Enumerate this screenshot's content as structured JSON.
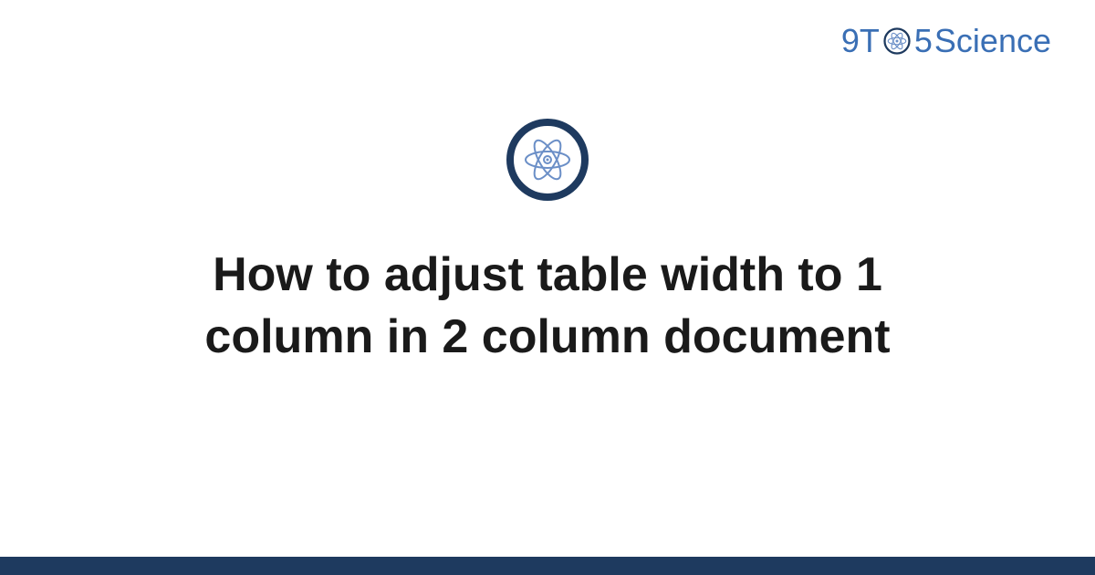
{
  "brand": {
    "prefix": "9T",
    "suffix": "5",
    "name": "Science"
  },
  "title": "How to adjust table width to 1 column in 2 column document",
  "colors": {
    "brand_blue": "#3a6fb5",
    "dark_navy": "#1e3a5f",
    "atom_light": "#6b8fc7"
  }
}
